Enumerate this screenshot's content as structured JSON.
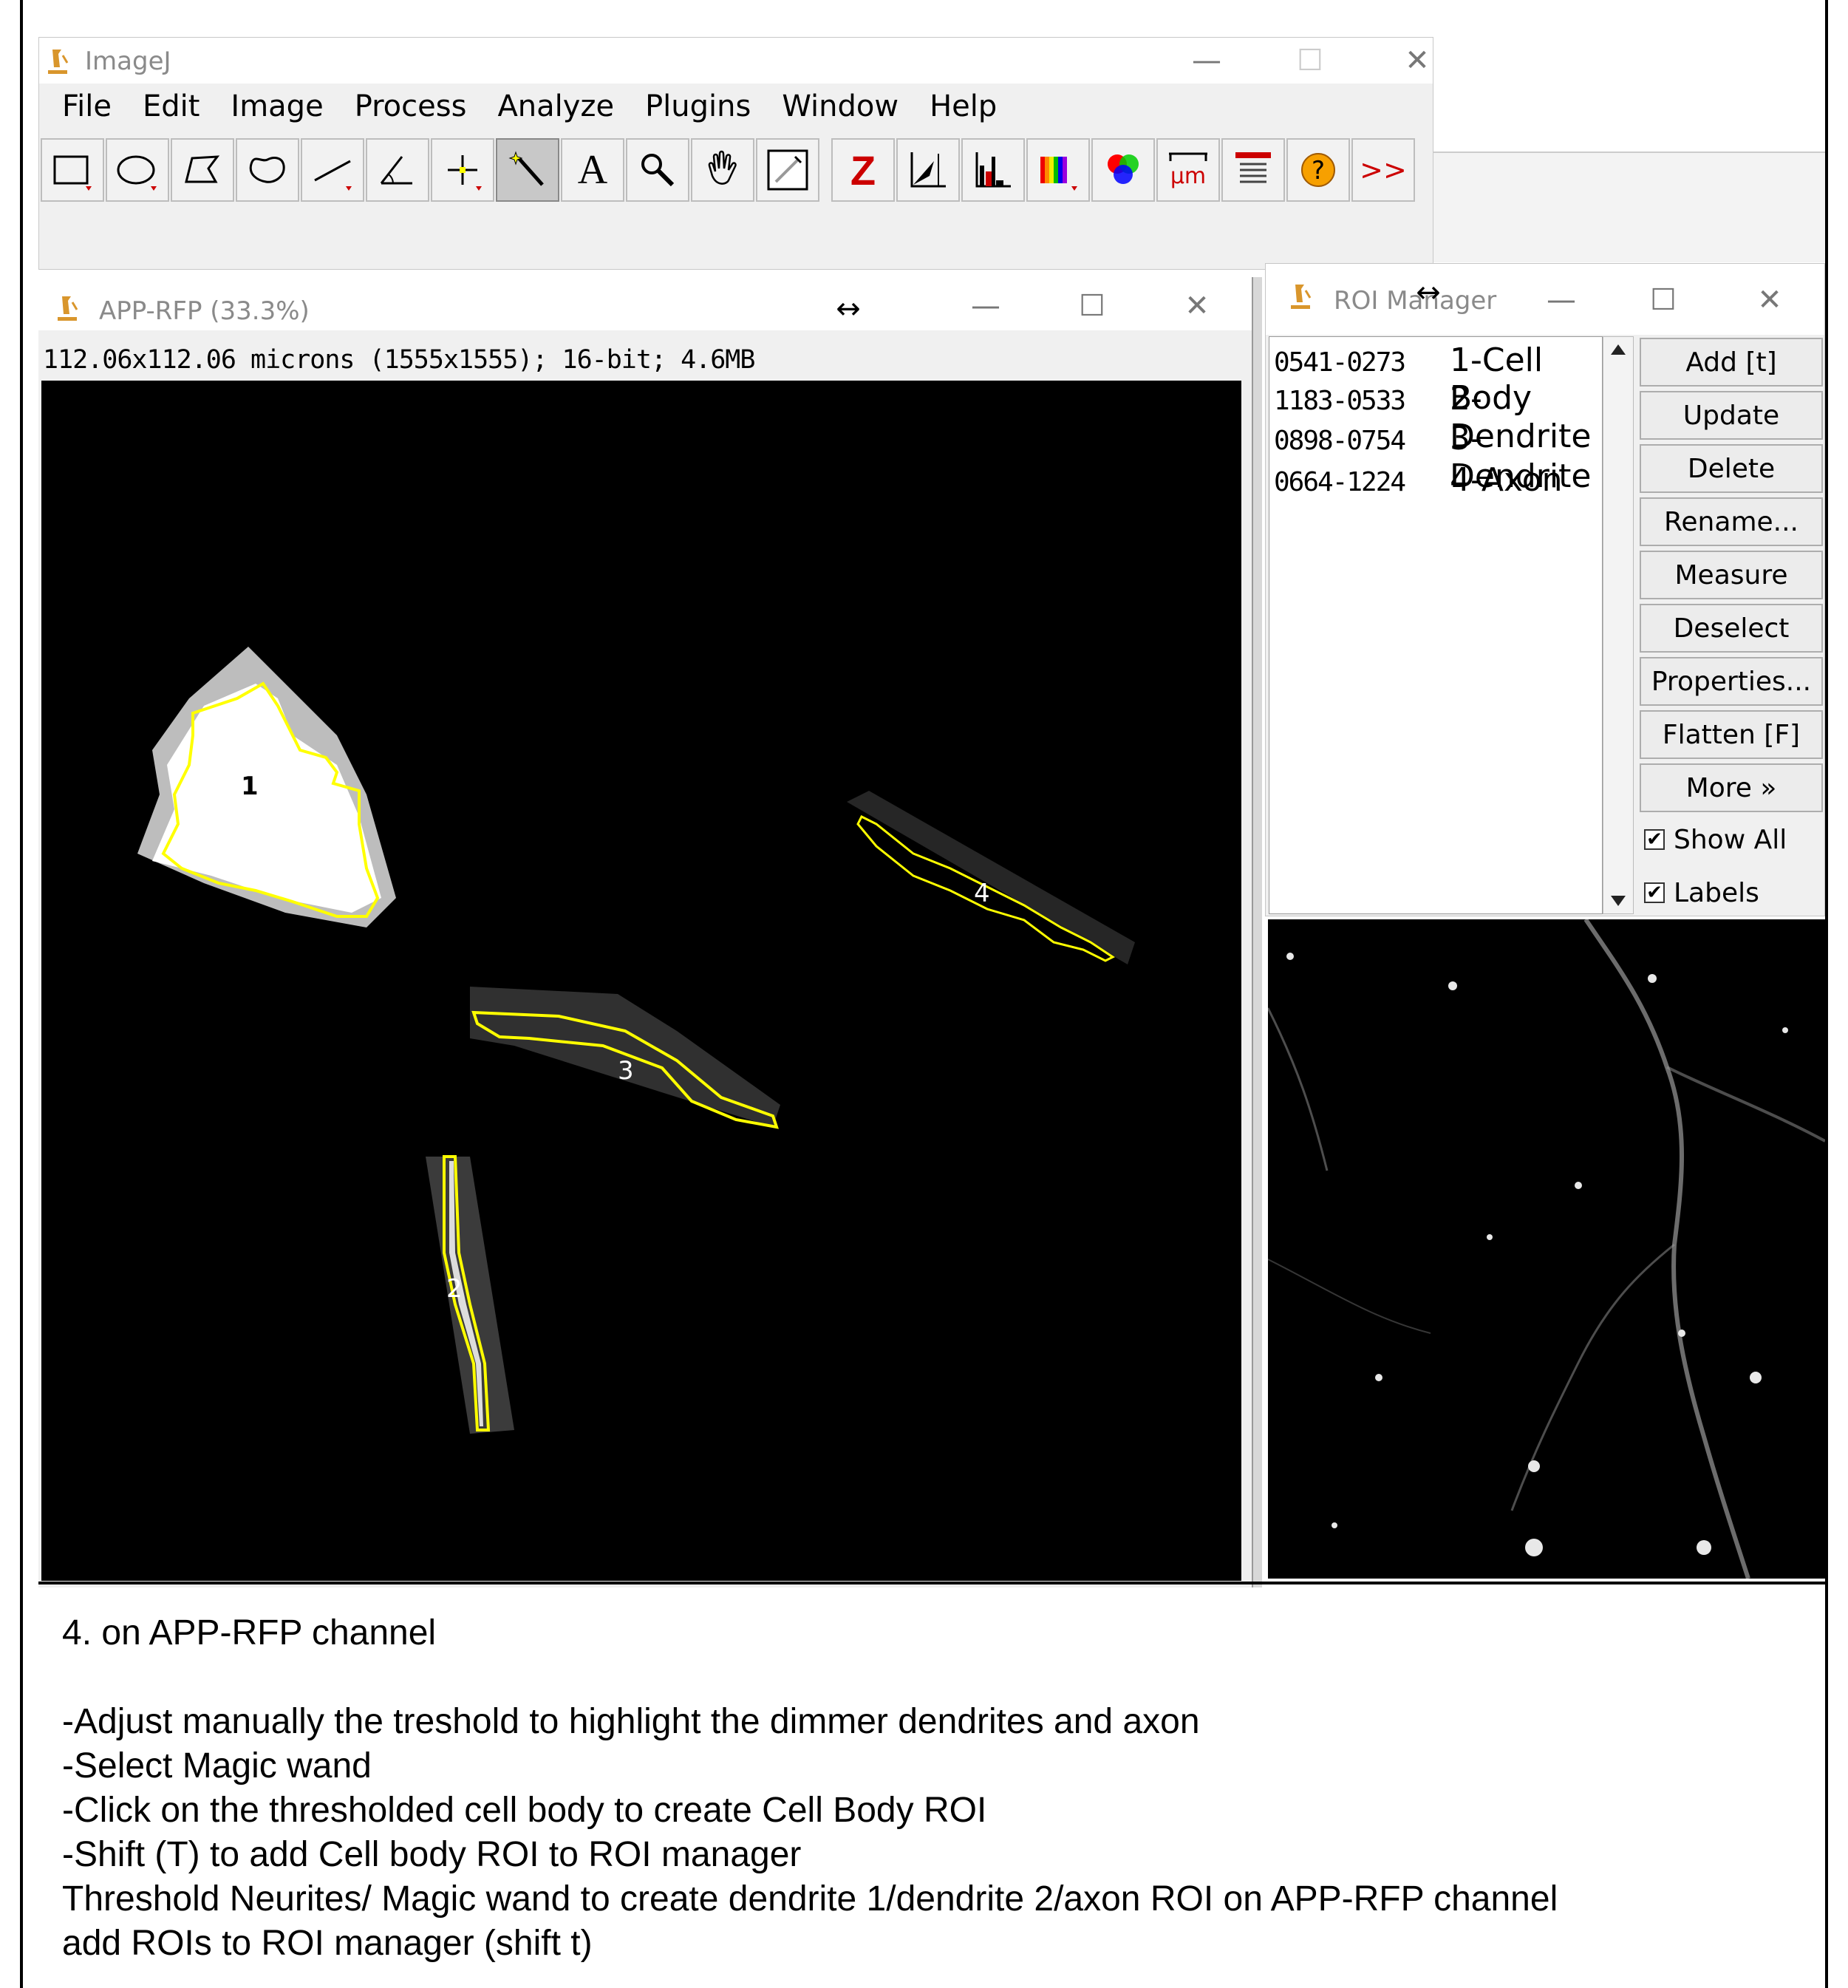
{
  "imagej": {
    "title": "ImageJ",
    "minimize_glyph": "—",
    "maximize_glyph": "☐",
    "close_glyph": "✕",
    "menus": [
      "File",
      "Edit",
      "Image",
      "Process",
      "Analyze",
      "Plugins",
      "Window",
      "Help"
    ],
    "tools": [
      {
        "name": "rectangle-tool-icon",
        "glyph": ""
      },
      {
        "name": "oval-tool-icon",
        "glyph": ""
      },
      {
        "name": "polygon-tool-icon",
        "glyph": ""
      },
      {
        "name": "freehand-tool-icon",
        "glyph": ""
      },
      {
        "name": "line-tool-icon",
        "glyph": ""
      },
      {
        "name": "angle-tool-icon",
        "glyph": ""
      },
      {
        "name": "point-tool-icon",
        "glyph": ""
      },
      {
        "name": "magic-wand-tool-icon",
        "glyph": ""
      },
      {
        "name": "text-tool-icon",
        "glyph": "A"
      },
      {
        "name": "zoom-tool-icon",
        "glyph": ""
      },
      {
        "name": "hand-tool-icon",
        "glyph": ""
      },
      {
        "name": "color-picker-tool-icon",
        "glyph": ""
      },
      {
        "name": "z-project-icon",
        "glyph": "Z"
      },
      {
        "name": "threshold-icon",
        "glyph": ""
      },
      {
        "name": "histogram-icon",
        "glyph": ""
      },
      {
        "name": "lut-icon",
        "glyph": ""
      },
      {
        "name": "channels-icon",
        "glyph": ""
      },
      {
        "name": "scale-icon",
        "glyph": "µm"
      },
      {
        "name": "results-table-icon",
        "glyph": ""
      },
      {
        "name": "help-icon",
        "glyph": "?"
      },
      {
        "name": "more-tools-icon",
        "glyph": ">>"
      }
    ],
    "selected_tool": "magic-wand-tool-icon"
  },
  "image_window": {
    "title": "APP-RFP (33.3%)",
    "info": "112.06x112.06 microns (1555x1555); 16-bit; 4.6MB",
    "roi_labels": [
      "1",
      "2",
      "3",
      "4"
    ]
  },
  "roi_manager": {
    "title": "ROI Manager",
    "rois": [
      {
        "code": "0541-0273",
        "name": "1-Cell Body"
      },
      {
        "code": "1183-0533",
        "name": "2-Dendrite"
      },
      {
        "code": "0898-0754",
        "name": "3-Dendrite"
      },
      {
        "code": "0664-1224",
        "name": "4-Axon"
      }
    ],
    "buttons": [
      "Add [t]",
      "Update",
      "Delete",
      "Rename...",
      "Measure",
      "Deselect",
      "Properties...",
      "Flatten [F]",
      "More »"
    ],
    "checkboxes": [
      {
        "label": "Show All",
        "checked": true
      },
      {
        "label": "Labels",
        "checked": true
      }
    ]
  },
  "instructions": [
    "4. on APP-RFP channel",
    "",
    "-Adjust manually the treshold to highlight the dimmer dendrites and axon",
    "-Select Magic wand",
    "-Click on the thresholded cell body to create Cell Body ROI",
    "-Shift (T) to add Cell body ROI to ROI manager",
    "Threshold Neurites/ Magic wand to create dendrite 1/dendrite 2/axon ROI on APP-RFP channel",
    "add ROIs to ROI manager (shift t)"
  ],
  "colors": {
    "roi_outline": "#ffff00",
    "z_icon": "#cc0000",
    "more_icon": "#cc0000"
  }
}
